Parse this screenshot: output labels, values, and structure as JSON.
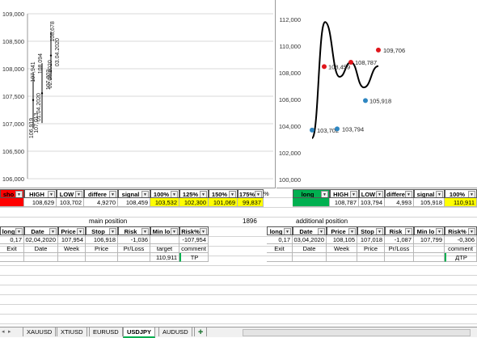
{
  "chart_data": [
    {
      "type": "scatter",
      "ylim": [
        106000,
        109000
      ],
      "yticks": [
        "106,000",
        "106,500",
        "107,000",
        "107,500",
        "108,000",
        "108,500",
        "109,000"
      ],
      "labels": [
        {
          "text": "106,919",
          "value": 106919
        },
        {
          "text": "107,013",
          "value": 107013
        },
        {
          "text": "107,941",
          "value": 107941
        },
        {
          "text": "01.04.2020",
          "value": 107300
        },
        {
          "text": "108,094",
          "value": 108094
        },
        {
          "text": "02.04.2020",
          "value": 107900
        },
        {
          "text": "107,802",
          "value": 107802
        },
        {
          "text": "108,678",
          "value": 108678
        },
        {
          "text": "03.04.2020",
          "value": 108300
        }
      ]
    },
    {
      "type": "line",
      "ylim": [
        100000,
        112000
      ],
      "yticks": [
        "100,000",
        "102,000",
        "104,000",
        "106,000",
        "108,000",
        "110,000",
        "112,000"
      ],
      "curve": [
        103100,
        111800,
        107700,
        108787,
        106900,
        108500
      ],
      "points": [
        {
          "label": "103,702",
          "value": 103702,
          "color": "#2e86c1"
        },
        {
          "label": "108,459",
          "value": 108459,
          "color": "#e0161c"
        },
        {
          "label": "103,794",
          "value": 103794,
          "color": "#2e86c1"
        },
        {
          "label": "108,787",
          "value": 108787,
          "color": "#e0161c"
        },
        {
          "label": "105,918",
          "value": 105918,
          "color": "#2e86c1"
        },
        {
          "label": "109,706",
          "value": 109706,
          "color": "#e0161c"
        }
      ]
    }
  ],
  "left": {
    "header": [
      "sho",
      "HIGH",
      "LOW",
      "differe",
      "signal",
      "100%",
      "125%",
      "150%",
      "175%",
      "%"
    ],
    "values": [
      "",
      "108,629",
      "103,702",
      "4,9270",
      "108,459",
      "103,532",
      "102,300",
      "101,069",
      "99,837"
    ],
    "section_title": "main position",
    "section_value": "1896",
    "pos_header": [
      "long",
      "Date",
      "Price",
      "Stop",
      "Risk",
      "Min lo",
      "Risk%"
    ],
    "pos_values": [
      "0,17",
      "02,04,2020",
      "107,954",
      "106,918",
      "-1,036",
      "",
      "-107,954"
    ],
    "pos_sub": [
      "Exit",
      "Date",
      "Week",
      "Price",
      "Pr/Loss",
      "target",
      "comment"
    ],
    "pos_target": "110,911",
    "pos_comment": "TP"
  },
  "right": {
    "header": [
      "long",
      "HIGH",
      "LOW",
      "differe",
      "signal",
      "100%"
    ],
    "values": [
      "",
      "108,787",
      "103,794",
      "4,993",
      "105,918",
      "110,911"
    ],
    "section_title": "additional position",
    "pos_header": [
      "long",
      "Date",
      "Price",
      "Stop",
      "Risk",
      "Min lo",
      "Risk%"
    ],
    "pos_values": [
      "0,17",
      "03,04,2020",
      "108,105",
      "107,018",
      "-1,087",
      "107,799",
      "-0,306"
    ],
    "pos_sub": [
      "Exit",
      "Date",
      "Week",
      "Price",
      "Pr/Loss",
      "",
      "comment"
    ],
    "pos_comment": "ДТР"
  },
  "tabs": [
    "XAUUSD",
    "XTIUSD",
    "EURUSD",
    "USDJPY",
    "AUDUSD"
  ],
  "active_tab": "USDJPY",
  "colors": {
    "red": "#ff0000",
    "green": "#00b050",
    "yellow": "#ffff00"
  }
}
